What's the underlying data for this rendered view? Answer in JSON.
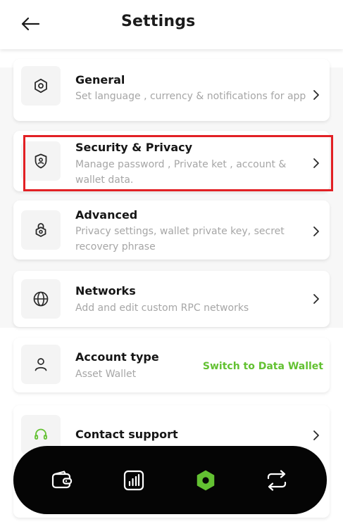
{
  "header": {
    "title": "Settings",
    "back_icon": "arrow-left-icon"
  },
  "settings": [
    {
      "id": "general",
      "title": "General",
      "description": "Set language , currency & notifications for app",
      "icon": "hexagon-icon",
      "chevron": "chevron-right-icon"
    },
    {
      "id": "security",
      "title": "Security & Privacy",
      "description": "Manage password , Private ket , account & wallet data.",
      "icon": "shield-user-icon",
      "chevron": "chevron-right-icon"
    },
    {
      "id": "advanced",
      "title": "Advanced",
      "description": "Privacy settings, wallet private key, secret recovery phrase",
      "icon": "lock-settings-icon",
      "chevron": "chevron-right-icon"
    },
    {
      "id": "networks",
      "title": "Networks",
      "description": "Add and edit custom RPC networks",
      "icon": "globe-icon",
      "chevron": "chevron-right-icon"
    }
  ],
  "account_type": {
    "title": "Account type",
    "value": "Asset Wallet",
    "action": "Switch to Data Wallet",
    "icon": "user-icon"
  },
  "contact_support": {
    "title": "Contact support",
    "icon": "headset-icon",
    "chevron": "chevron-right-icon"
  },
  "bottom_nav": [
    {
      "name": "wallet",
      "icon": "wallet-icon",
      "active": false
    },
    {
      "name": "stats",
      "icon": "bar-chart-icon",
      "active": false
    },
    {
      "name": "settings",
      "icon": "hexagon-settings-icon",
      "active": true
    },
    {
      "name": "swap",
      "icon": "swap-arrows-icon",
      "active": false
    }
  ],
  "colors": {
    "accent": "#63c132",
    "highlight": "#e22024",
    "nav_bg": "#050505",
    "muted_text": "#a6a6a6"
  }
}
